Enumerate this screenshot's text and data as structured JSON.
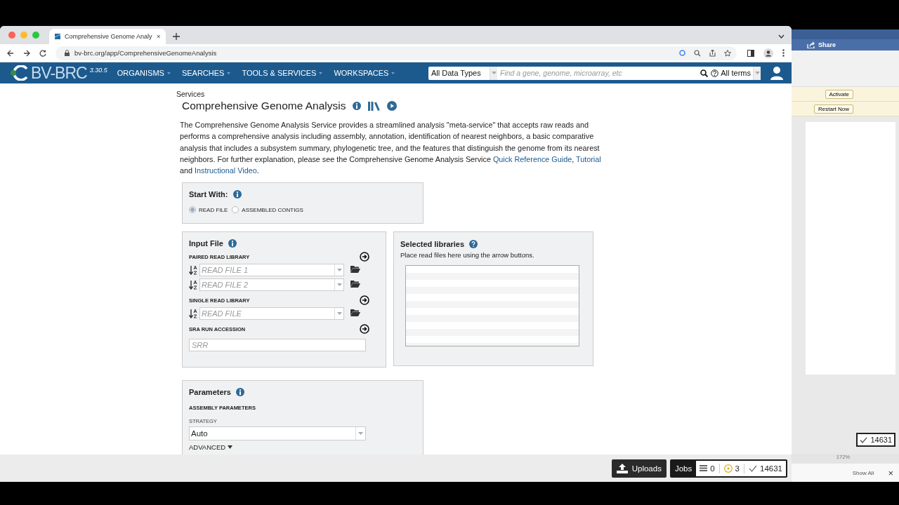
{
  "browser": {
    "tab_title": "Comprehensive Genome Analy",
    "url": "bv-brc.org/app/ComprehensiveGenomeAnalysis"
  },
  "navbar": {
    "logo": "BV-BRC",
    "version": "3.30.5",
    "menus": [
      "ORGANISMS",
      "SEARCHES",
      "TOOLS & SERVICES",
      "WORKSPACES"
    ],
    "data_type": "All Data Types",
    "search_placeholder": "Find a gene, genome, microarray, etc",
    "terms": "All terms"
  },
  "page": {
    "breadcrumb": "Services",
    "title": "Comprehensive Genome Analysis",
    "description": [
      {
        "kind": "text",
        "text": "The Comprehensive Genome Analysis Service provides a streamlined analysis \"meta-service\" that accepts raw reads and performs a comprehensive analysis including assembly, annotation, identification of nearest neighbors, a basic comparative analysis that includes a subsystem summary, phylogenetic tree, and the features that distinguish the genome from its nearest neighbors. For further explanation, please see the Comprehensive Genome Analysis Service "
      },
      {
        "kind": "link",
        "text": "Quick Reference Guide"
      },
      {
        "kind": "text",
        "text": ", "
      },
      {
        "kind": "link",
        "text": "Tutorial"
      },
      {
        "kind": "text",
        "text": " and "
      },
      {
        "kind": "link",
        "text": "Instructional Video"
      },
      {
        "kind": "text",
        "text": "."
      }
    ],
    "start_with": {
      "label": "Start With:",
      "options": [
        {
          "label": "READ FILE",
          "selected": true
        },
        {
          "label": "ASSEMBLED CONTIGS",
          "selected": false
        }
      ]
    },
    "input_file": {
      "title": "Input File",
      "sections": [
        {
          "label": "PAIRED READ LIBRARY",
          "kind": "select",
          "fields": [
            {
              "placeholder": "READ FILE 1"
            },
            {
              "placeholder": "READ FILE 2"
            }
          ]
        },
        {
          "label": "SINGLE READ LIBRARY",
          "kind": "select",
          "fields": [
            {
              "placeholder": "READ FILE"
            }
          ]
        },
        {
          "label": "SRA RUN ACCESSION",
          "kind": "text",
          "fields": [
            {
              "placeholder": "SRR"
            }
          ]
        }
      ]
    },
    "selected_libraries": {
      "title": "Selected libraries",
      "hint": "Place read files here using the arrow buttons."
    },
    "parameters": {
      "title": "Parameters",
      "section": "ASSEMBLY PARAMETERS",
      "strategy_label": "STRATEGY",
      "strategy_value": "Auto",
      "advanced": "ADVANCED"
    }
  },
  "bottom_bar": {
    "uploads": "Uploads",
    "jobs": {
      "label": "Jobs",
      "queued": "0",
      "running": "3",
      "completed": "14631"
    }
  },
  "background_window": {
    "share": "Share",
    "activate": "Activate",
    "restart": "Restart Now",
    "count": "14631",
    "zoom": "172%",
    "show_all": "Show All",
    "close": "×"
  }
}
